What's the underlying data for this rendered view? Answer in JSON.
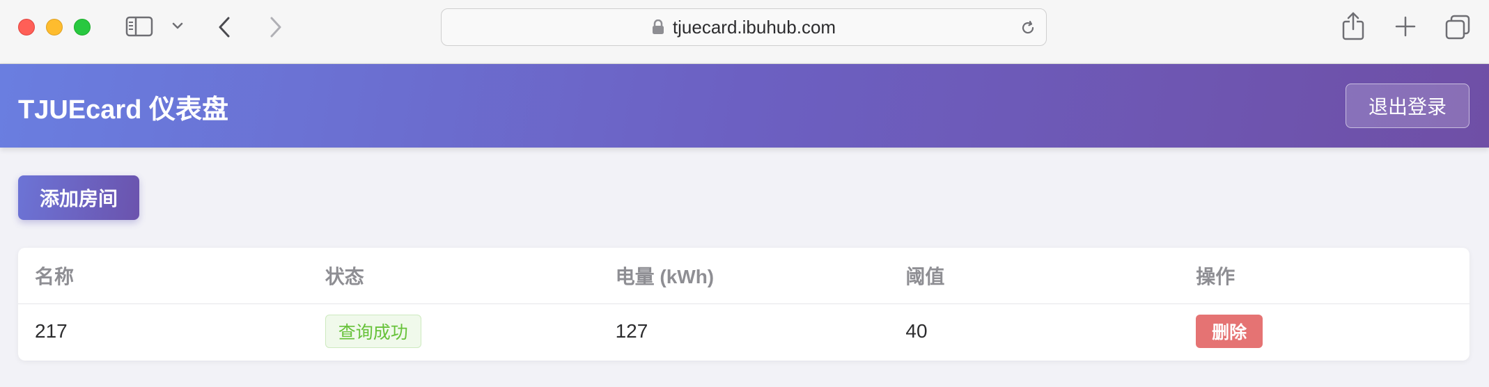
{
  "browser": {
    "url": "tjuecard.ibuhub.com",
    "icons": {
      "sidebar": "sidebar-icon",
      "tab_menu": "chevron-down-icon",
      "back": "chevron-left-icon",
      "forward": "chevron-right-icon",
      "lock": "lock-icon",
      "reload": "reload-icon",
      "share": "share-icon",
      "new_tab": "plus-icon",
      "tabs": "tabs-overview-icon"
    }
  },
  "header": {
    "title": "TJUEcard 仪表盘",
    "logout_label": "退出登录"
  },
  "actions": {
    "add_room_label": "添加房间"
  },
  "table": {
    "columns": [
      "名称",
      "状态",
      "电量 (kWh)",
      "阈值",
      "操作"
    ],
    "rows": [
      {
        "name": "217",
        "status": "查询成功",
        "power": "127",
        "threshold": "40",
        "action": "删除"
      }
    ]
  },
  "colors": {
    "header_gradient_start": "#6a7ee0",
    "header_gradient_end": "#6f4fa6",
    "status_success": "#67c23a",
    "danger": "#e57373"
  }
}
